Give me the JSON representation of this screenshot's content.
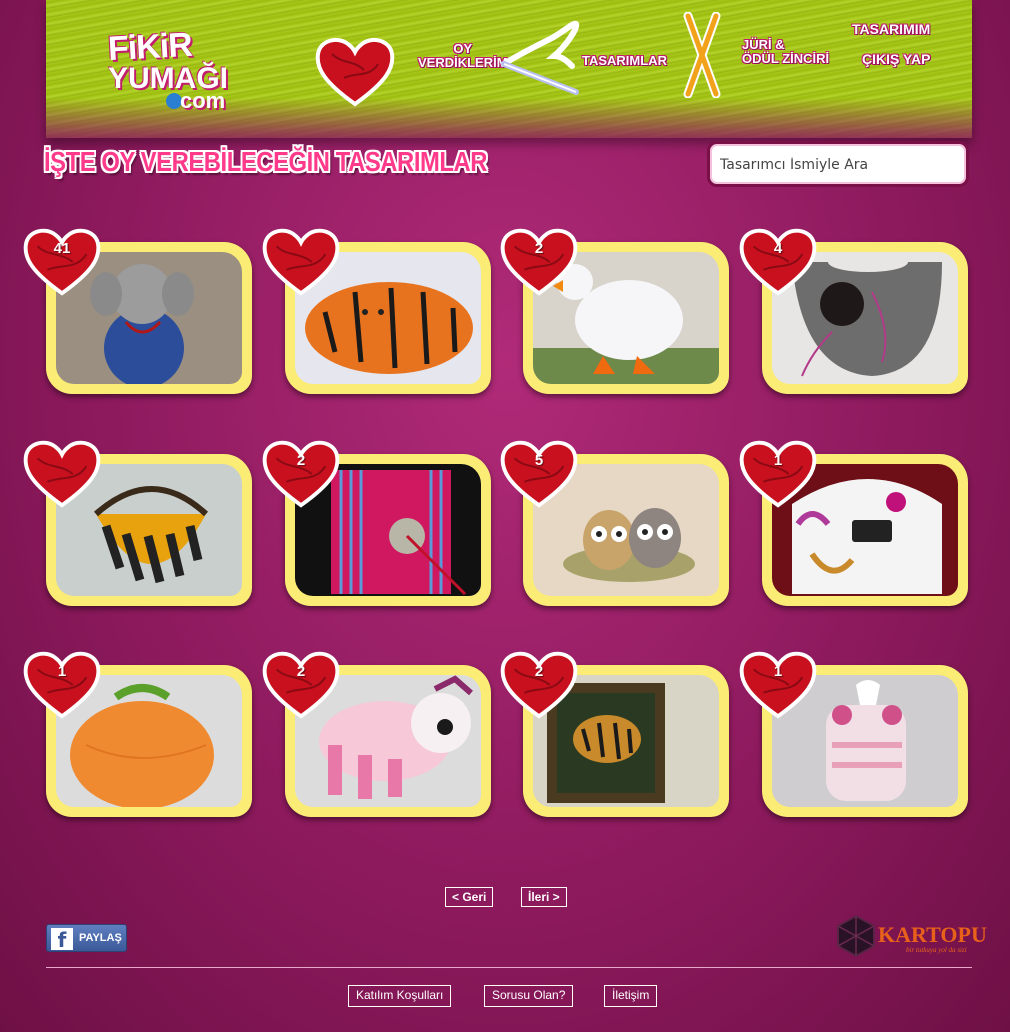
{
  "header": {
    "logo": {
      "line1": "FiKiR",
      "line2": "YUMAĞI",
      "line3": "com"
    },
    "nav": {
      "voted": [
        "OY",
        "VERDİKLERİM"
      ],
      "designs": "TASARIMLAR",
      "jury": [
        "JÜRİ &",
        "ÖDÜL ZİNCİRİ"
      ],
      "my_design": "TASARIMIM",
      "logout": "ÇIKIŞ YAP"
    }
  },
  "page_title": "İŞTE OY VEREBİLECEĞİN TASARIMLAR",
  "search": {
    "placeholder": "Tasarımcı İsmiyle Ara"
  },
  "cards": [
    {
      "votes": "41",
      "subject": "knitted-elephant"
    },
    {
      "votes": "",
      "subject": "knitted-tiger-pillow"
    },
    {
      "votes": "2",
      "subject": "fluffy-goose"
    },
    {
      "votes": "4",
      "subject": "felt-bag"
    },
    {
      "votes": "",
      "subject": "striped-crochet-bag"
    },
    {
      "votes": "2",
      "subject": "striped-pink-pouch"
    },
    {
      "votes": "5",
      "subject": "crochet-owls"
    },
    {
      "votes": "1",
      "subject": "decorated-white-hat"
    },
    {
      "votes": "1",
      "subject": "crochet-orange-basket"
    },
    {
      "votes": "2",
      "subject": "pink-crochet-bunny"
    },
    {
      "votes": "2",
      "subject": "tiger-tapestry"
    },
    {
      "votes": "1",
      "subject": "tissue-box-cover"
    }
  ],
  "pagination": {
    "prev": "< Geri",
    "next": "İleri >"
  },
  "share": {
    "label": "PAYLAŞ"
  },
  "brand": {
    "name": "KARTOPU",
    "tagline": "bir tutkuya yol da sizi"
  },
  "footer": {
    "terms": "Katılım Koşulları",
    "faq": "Sorusu Olan?",
    "contact": "İletişim"
  },
  "colors": {
    "background": "#8e1a5e",
    "header_green": "#a8c81a",
    "card_frame": "#fbec76",
    "heart_red": "#c8101e",
    "title_pink": "#ff3a8a"
  }
}
